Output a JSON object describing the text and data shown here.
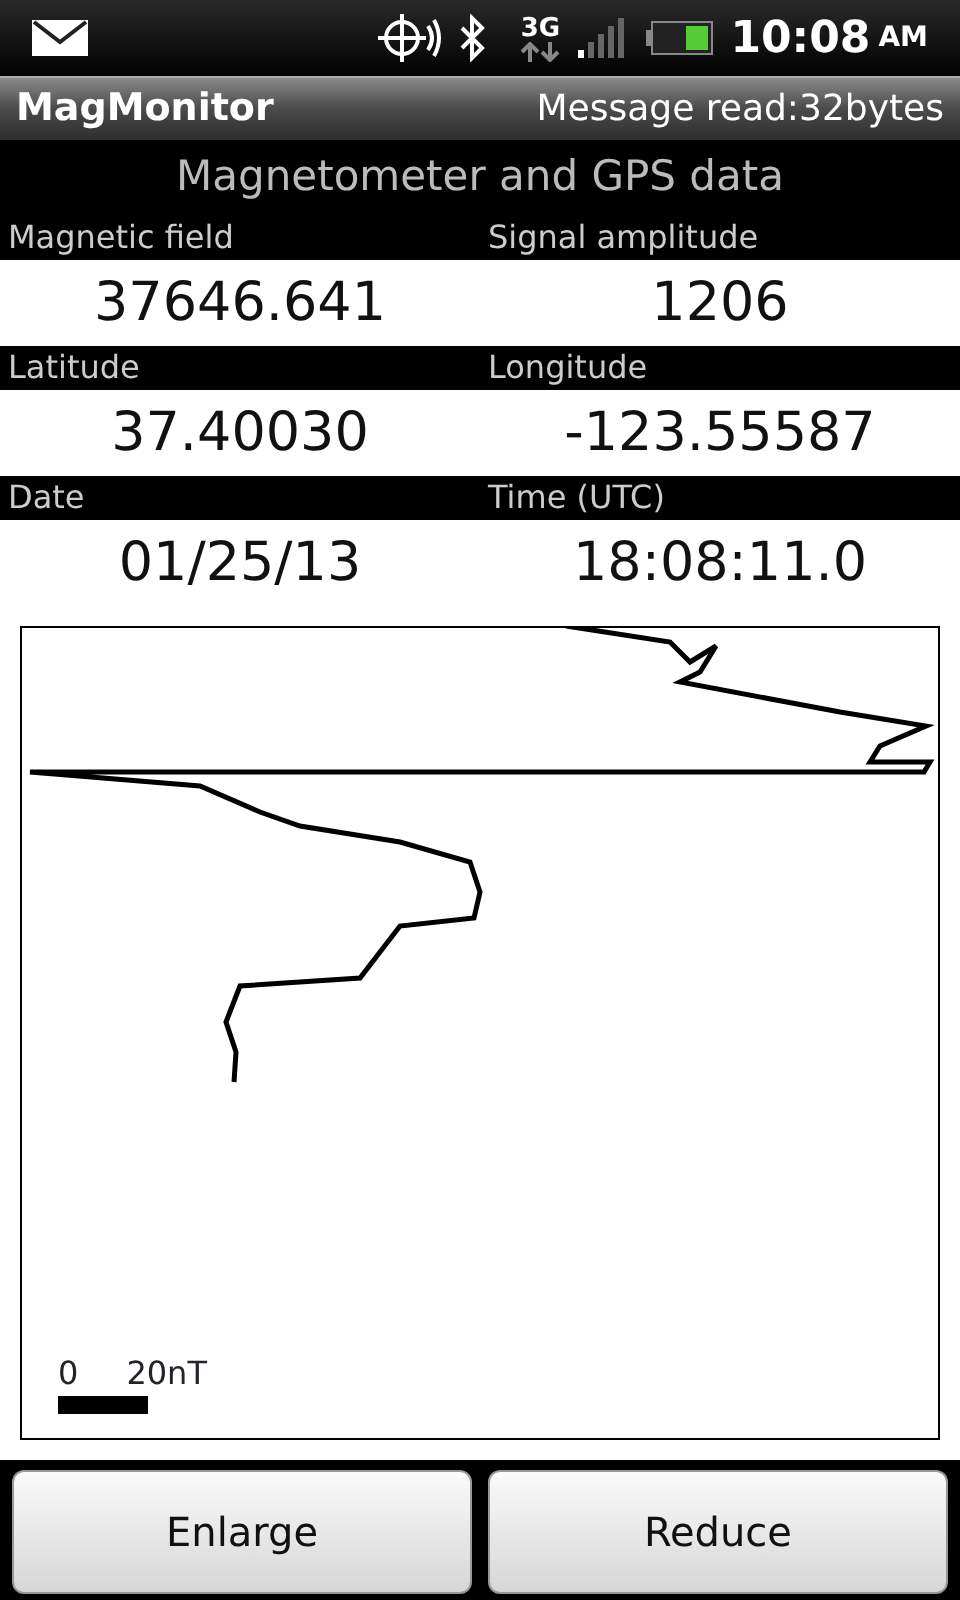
{
  "status_bar": {
    "network": "3G",
    "time": "10:08",
    "ampm": "AM"
  },
  "app_bar": {
    "title": "MagMonitor",
    "message": "Message read:32bytes"
  },
  "section_title": "Magnetometer and GPS data",
  "readings": [
    {
      "label": "Magnetic field",
      "value": "37646.641"
    },
    {
      "label": "Signal amplitude",
      "value": "1206"
    },
    {
      "label": "Latitude",
      "value": "37.40030"
    },
    {
      "label": "Longitude",
      "value": "-123.55587"
    },
    {
      "label": "Date",
      "value": "01/25/13"
    },
    {
      "label": "Time (UTC)",
      "value": "18:08:11.0"
    }
  ],
  "plot": {
    "scale_zero": "0",
    "scale_label": "20nT"
  },
  "buttons": [
    "Enlarge",
    "Reduce"
  ]
}
